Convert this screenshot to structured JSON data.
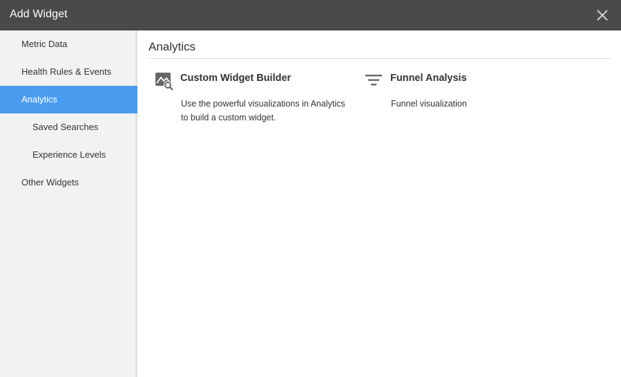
{
  "dialog": {
    "title": "Add Widget",
    "close_icon": "close-icon"
  },
  "sidebar": {
    "items": [
      {
        "label": "Metric Data"
      },
      {
        "label": "Health Rules & Events"
      },
      {
        "label": "Analytics"
      },
      {
        "label": "Saved Searches"
      },
      {
        "label": "Experience Levels"
      },
      {
        "label": "Other Widgets"
      }
    ],
    "active_item": "Analytics",
    "active_color": "#4a9cf0"
  },
  "main": {
    "section_title": "Analytics",
    "cards": [
      {
        "icon": "image-search-icon",
        "title": "Custom Widget Builder",
        "desc_line1": "Use the powerful visualizations in Analytics",
        "desc_line2": "to build a custom widget."
      },
      {
        "icon": "funnel-icon",
        "title": "Funnel Analysis",
        "desc_line1": "Funnel visualization"
      }
    ]
  }
}
